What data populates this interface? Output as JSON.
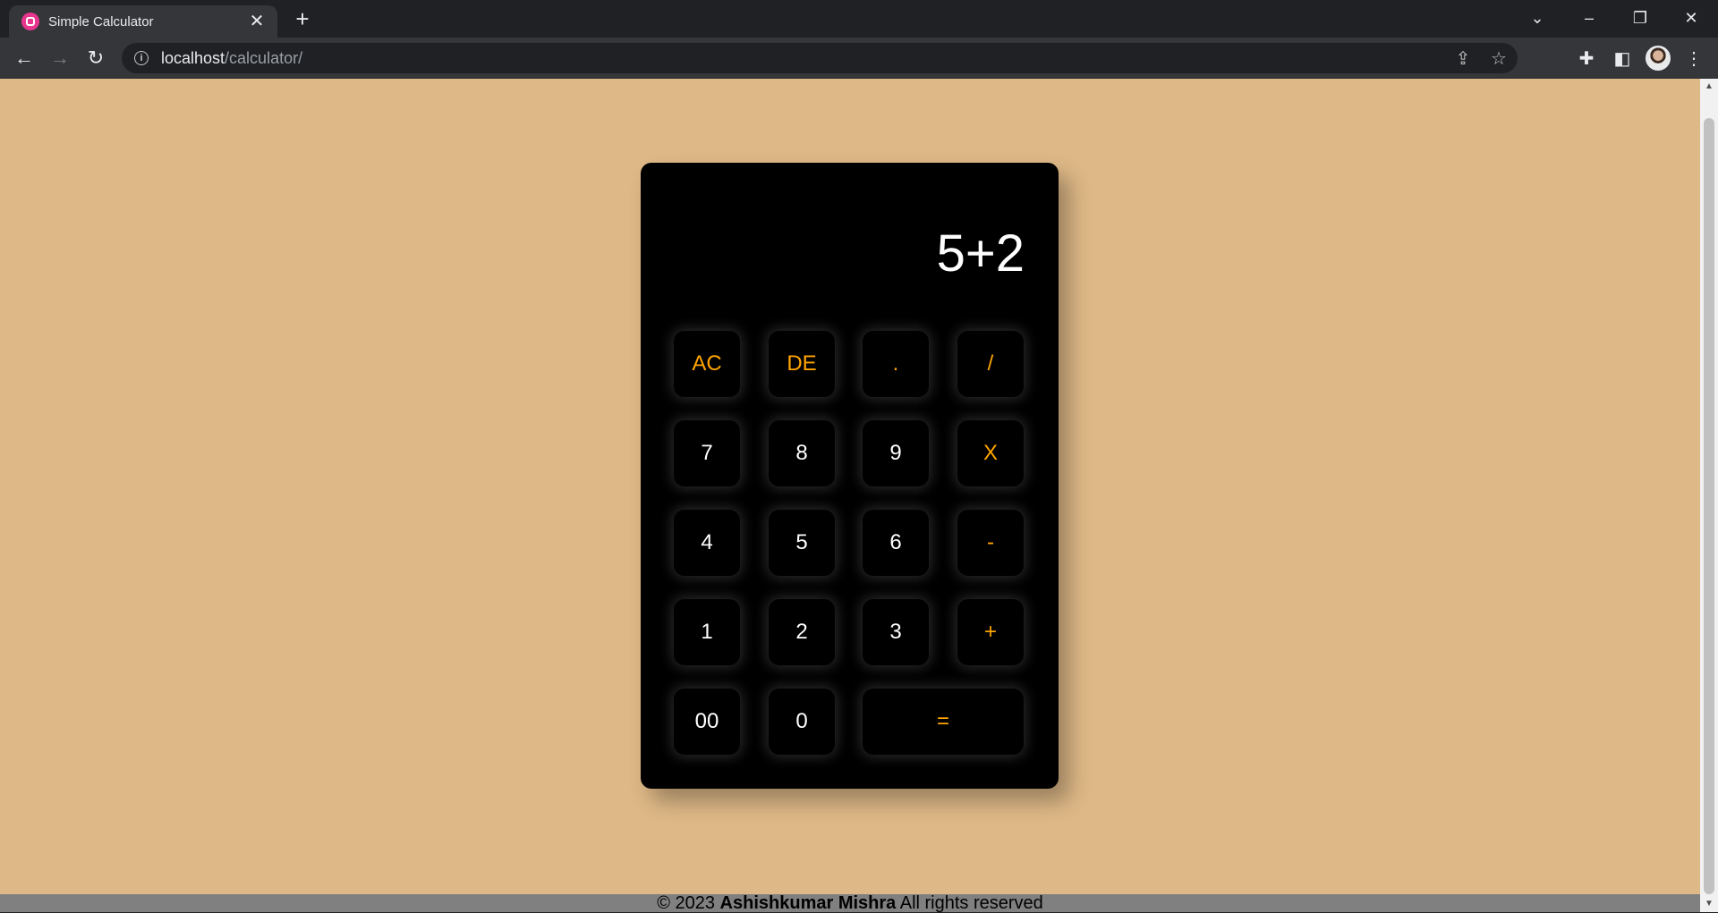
{
  "browser": {
    "tab_title": "Simple Calculator",
    "url_host": "localhost",
    "url_path": "/calculator/"
  },
  "calculator": {
    "display": "5+2",
    "rows": [
      [
        {
          "label": "AC",
          "type": "op"
        },
        {
          "label": "DE",
          "type": "op"
        },
        {
          "label": ".",
          "type": "op"
        },
        {
          "label": "/",
          "type": "op"
        }
      ],
      [
        {
          "label": "7",
          "type": "num"
        },
        {
          "label": "8",
          "type": "num"
        },
        {
          "label": "9",
          "type": "num"
        },
        {
          "label": "X",
          "type": "op"
        }
      ],
      [
        {
          "label": "4",
          "type": "num"
        },
        {
          "label": "5",
          "type": "num"
        },
        {
          "label": "6",
          "type": "num"
        },
        {
          "label": "-",
          "type": "op"
        }
      ],
      [
        {
          "label": "1",
          "type": "num"
        },
        {
          "label": "2",
          "type": "num"
        },
        {
          "label": "3",
          "type": "num"
        },
        {
          "label": "+",
          "type": "op"
        }
      ],
      [
        {
          "label": "00",
          "type": "num"
        },
        {
          "label": "0",
          "type": "num"
        },
        {
          "label": "=",
          "type": "op"
        }
      ]
    ]
  },
  "footer": {
    "prefix": "© 2023",
    "author": "Ashishkumar Mishra",
    "suffix": "All rights reserved"
  },
  "colors": {
    "page_background": "#deb887",
    "calculator_body": "#000000",
    "operator_text": "#ffa500",
    "digit_text": "#ffffff",
    "footer_bar": "#808080"
  }
}
